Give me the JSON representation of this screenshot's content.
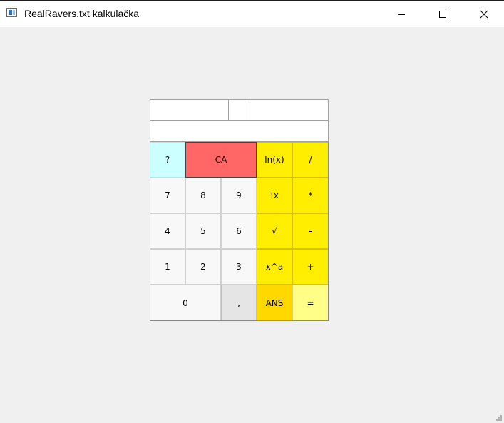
{
  "window": {
    "title": "RealRavers.txt kalkulačka",
    "app_icon": "notepad-window-icon",
    "controls": {
      "minimize_icon": "minimize-icon",
      "maximize_icon": "maximize-icon",
      "close_icon": "close-icon"
    }
  },
  "display": {
    "operand_left": "",
    "operator": "",
    "operand_right": "",
    "result": ""
  },
  "keypad": {
    "help": "?",
    "clear_all": "CA",
    "ln": "ln(x)",
    "divide": "/",
    "seven": "7",
    "eight": "8",
    "nine": "9",
    "factorial": "!x",
    "multiply": "*",
    "four": "4",
    "five": "5",
    "six": "6",
    "sqrt": "√",
    "subtract": "-",
    "one": "1",
    "two": "2",
    "three": "3",
    "power": "x^a",
    "add": "+",
    "zero": "0",
    "comma": ",",
    "ans": "ANS",
    "equals": "="
  },
  "colors": {
    "window_bg": "#f0f0f0",
    "operator_yellow": "#ffee00",
    "help_cyan": "#ccffff",
    "clear_red": "#ff6666",
    "ans_gold": "#ffd800",
    "equals_light_yellow": "#ffff88",
    "digit_bg": "#f8f8f8"
  }
}
